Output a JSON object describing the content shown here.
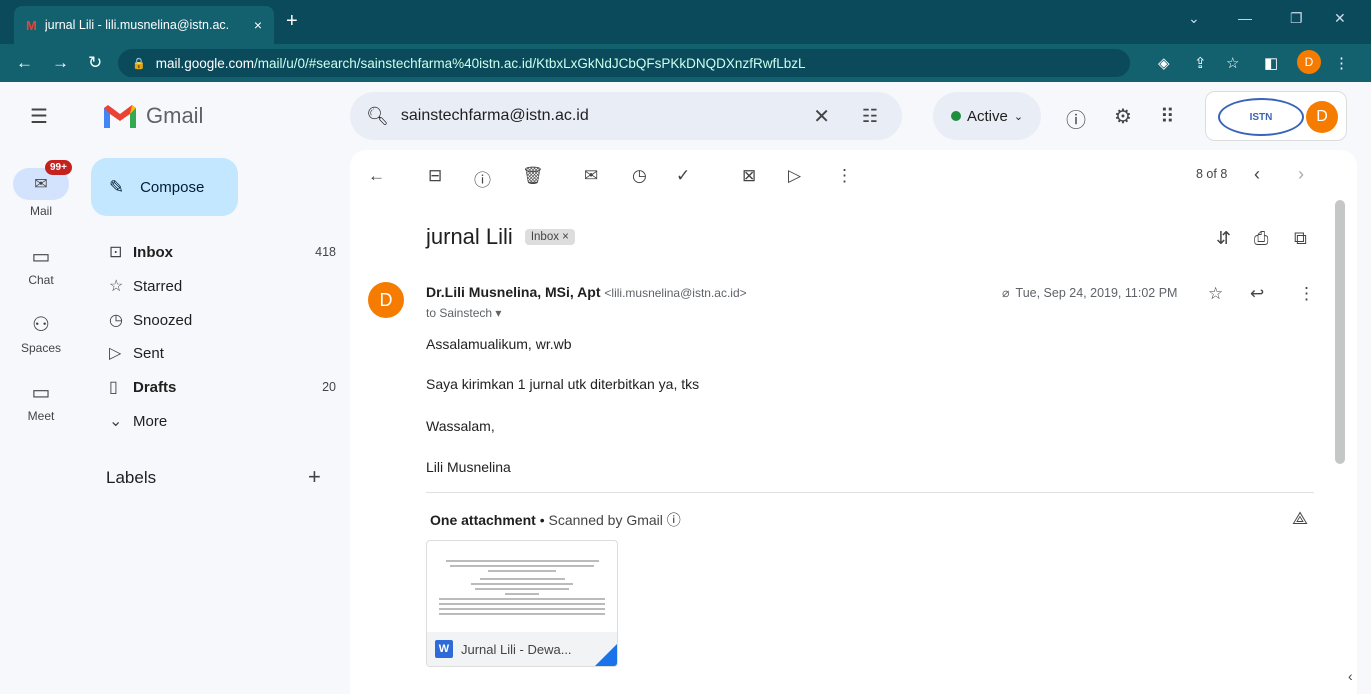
{
  "browser": {
    "tab_title": "jurnal Lili - lili.musnelina@istn.ac.",
    "tab_close": "×",
    "new_tab": "+",
    "url_host": "mail.google.com",
    "url_path": "/mail/u/0/#search/sainstechfarma%40istn.ac.id/KtbxLxGkNdJCbQFsPKkDNQDXnzfRwfLbzL",
    "profile_initial": "D"
  },
  "gmail": {
    "brand": "Gmail",
    "search_value": "sainstechfarma@istn.ac.id",
    "status": "Active",
    "org_logo_text": "ISTN",
    "account_initial": "D"
  },
  "rail": {
    "mail": "Mail",
    "mail_badge": "99+",
    "chat": "Chat",
    "spaces": "Spaces",
    "meet": "Meet"
  },
  "compose_label": "Compose",
  "folders": [
    {
      "label": "Inbox",
      "count": "418",
      "icon": "inbox-icon"
    },
    {
      "label": "Starred",
      "count": "",
      "icon": "star-icon"
    },
    {
      "label": "Snoozed",
      "count": "",
      "icon": "clock-icon"
    },
    {
      "label": "Sent",
      "count": "",
      "icon": "send-icon"
    },
    {
      "label": "Drafts",
      "count": "20",
      "icon": "draft-icon"
    },
    {
      "label": "More",
      "count": "",
      "icon": "chevron-down-icon"
    }
  ],
  "labels_header": "Labels",
  "pager": "8 of 8",
  "email": {
    "subject": "jurnal Lili",
    "tag": "Inbox ×",
    "sender_name": "Dr.Lili Musnelina, MSi, Apt",
    "sender_email": "<lili.musnelina@istn.ac.id>",
    "to": "to Sainstech ▾",
    "date": "Tue, Sep 24, 2019, 11:02 PM",
    "avatar_initial": "D",
    "body": [
      "Assalamualikum, wr.wb",
      "Saya kirimkan 1 jurnal utk diterbitkan ya, tks",
      "Wassalam,",
      "Lili Musnelina"
    ]
  },
  "attachment": {
    "count_label": "One attachment",
    "separator": "•",
    "scan_label": "Scanned by Gmail",
    "file_name": "Jurnal Lili - Dewa...",
    "file_type": "W"
  },
  "colors": {
    "chrome": "#13606f",
    "compose": "#c2e7ff",
    "avatar": "#f57c00"
  }
}
